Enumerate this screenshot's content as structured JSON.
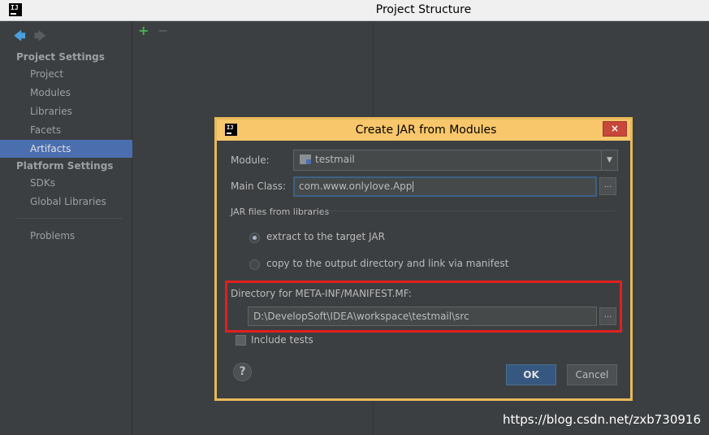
{
  "window": {
    "title": "Project Structure"
  },
  "sidebar": {
    "sections": [
      {
        "title": "Project Settings",
        "items": [
          "Project",
          "Modules",
          "Libraries",
          "Facets",
          "Artifacts"
        ]
      },
      {
        "title": "Platform Settings",
        "items": [
          "SDKs",
          "Global Libraries"
        ]
      }
    ],
    "extra_items": [
      "Problems"
    ],
    "selected": "Artifacts"
  },
  "toolbar": {
    "add": "+",
    "remove": "−"
  },
  "dialog": {
    "title": "Create JAR from Modules",
    "close": "×",
    "module_label": "Module:",
    "module_value": "testmail",
    "main_class_label": "Main Class:",
    "main_class_value": "com.www.onlylove.App",
    "browse": "...",
    "jar_group_label": "JAR files from libraries",
    "option_extract": "extract to the target JAR",
    "option_copy": "copy to the output directory and link via manifest",
    "manifest_label": "Directory for META-INF/MANIFEST.MF:",
    "manifest_value": "D:\\DevelopSoft\\IDEA\\workspace\\testmail\\src",
    "include_tests": "Include tests",
    "help": "?",
    "ok": "OK",
    "cancel": "Cancel"
  },
  "watermark": "https://blog.csdn.net/zxb730916"
}
